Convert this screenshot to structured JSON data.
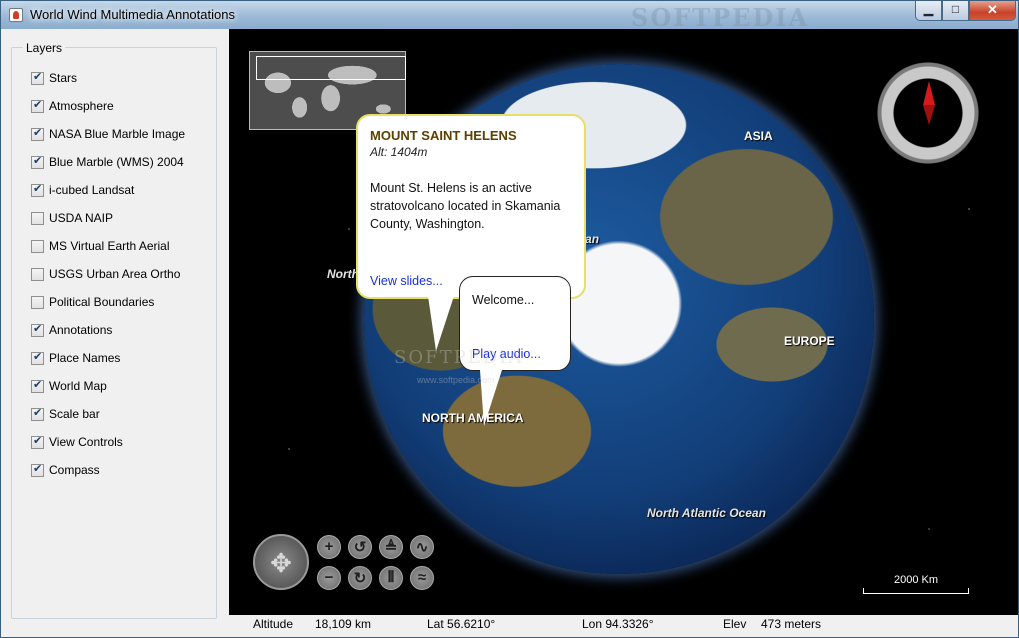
{
  "window": {
    "title": "World Wind Multimedia Annotations",
    "watermark": "SOFTPEDIA",
    "buttons": {
      "minimize": "▁",
      "maximize": "□",
      "close": "✕"
    }
  },
  "layers": {
    "label": "Layers",
    "items": [
      {
        "name": "Stars",
        "checked": true
      },
      {
        "name": "Atmosphere",
        "checked": true
      },
      {
        "name": "NASA Blue Marble Image",
        "checked": true
      },
      {
        "name": "Blue Marble (WMS) 2004",
        "checked": true
      },
      {
        "name": "i-cubed Landsat",
        "checked": true
      },
      {
        "name": "USDA NAIP",
        "checked": false
      },
      {
        "name": "MS Virtual Earth Aerial",
        "checked": false
      },
      {
        "name": "USGS Urban Area Ortho",
        "checked": false
      },
      {
        "name": "Political Boundaries",
        "checked": false
      },
      {
        "name": "Annotations",
        "checked": true
      },
      {
        "name": "Place Names",
        "checked": true
      },
      {
        "name": "World Map",
        "checked": true
      },
      {
        "name": "Scale bar",
        "checked": true
      },
      {
        "name": "View Controls",
        "checked": true
      },
      {
        "name": "Compass",
        "checked": true
      }
    ]
  },
  "globe": {
    "labels": {
      "asia": "ASIA",
      "arctic": "Arctic Ocean",
      "north": "North",
      "europe": "EUROPE",
      "north_america": "NORTH AMERICA",
      "north_atlantic": "North Atlantic Ocean"
    },
    "watermark": "SOFTPEDIA",
    "watermark_url": "www.softpedia.com"
  },
  "annotation_main": {
    "title": "MOUNT SAINT HELENS",
    "altitude": "Alt: 1404m",
    "body": "Mount St. Helens is an active stratovolcano located in Skamania County, Washington.",
    "link": "View slides..."
  },
  "annotation_audio": {
    "text": "Welcome...",
    "link": "Play audio..."
  },
  "view_controls": {
    "pan": "✥",
    "zoom_in": "+",
    "zoom_out": "−",
    "rotate_left": "↺",
    "rotate_right": "↻",
    "pitch_up": "≜",
    "pitch_down": "⫴",
    "exaggerate_up": "∿",
    "exaggerate_down": "≈"
  },
  "scalebar": {
    "label": "2000 Km"
  },
  "status": {
    "altitude_label": "Altitude",
    "altitude_value": "18,109 km",
    "lat": "Lat 56.6210°",
    "lon": "Lon 94.3326°",
    "elev_label": "Elev",
    "elev_value": "473 meters"
  },
  "colors": {
    "titlebar": "#9db9d6",
    "annotation_border": "#e6df6a",
    "annotation_title": "#5c4000",
    "link": "#1a2fd6",
    "compass_needle": "#d41a1a"
  }
}
